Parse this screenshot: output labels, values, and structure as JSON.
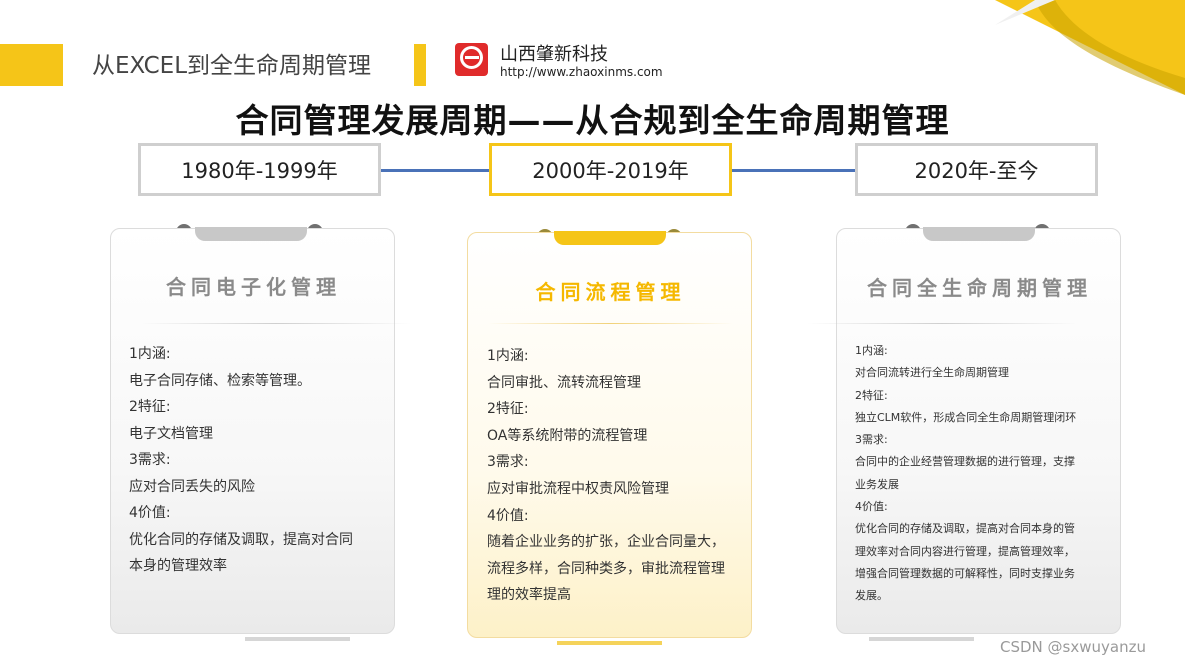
{
  "header": {
    "title": "从EXCEL到全生命周期管理",
    "company_name": "山西肇新科技",
    "company_url": "http://www.zhaoxinms.com"
  },
  "main_title": "合同管理发展周期——从合规到全生命周期管理",
  "periods": [
    {
      "label": "1980年-1999年"
    },
    {
      "label": "2000年-2019年"
    },
    {
      "label": "2020年-至今"
    }
  ],
  "cards": [
    {
      "title": "合同电子化管理",
      "lines": [
        "1内涵:",
        "电子合同存储、检索等管理。",
        "2特征:",
        "电子文档管理",
        "3需求:",
        "应对合同丢失的风险",
        "4价值:",
        "优化合同的存储及调取，提高对合同",
        "本身的管理效率"
      ]
    },
    {
      "title": "合同流程管理",
      "lines": [
        "1内涵:",
        "合同审批、流转流程管理",
        "2特征:",
        "OA等系统附带的流程管理",
        "3需求:",
        "应对审批流程中权责风险管理",
        "4价值:",
        "随着企业业务的扩张，企业合同量大，",
        "流程多样，合同种类多，审批流程管理",
        "理的效率提高"
      ]
    },
    {
      "title": "合同全生命周期管理",
      "lines": [
        "1内涵:",
        "对合同流转进行全生命周期管理",
        "2特征:",
        "独立CLM软件，形成合同全生命周期管理闭环",
        "3需求:",
        "合同中的企业经营管理数据的进行管理，支撑",
        "业务发展",
        "4价值:",
        "优化合同的存储及调取，提高对合同本身的管",
        "理效率对合同内容进行管理，提高管理效率，",
        "增强合同管理数据的可解释性，同时支撑业务",
        "发展。"
      ]
    }
  ],
  "watermark": "CSDN @sxwuyanzu",
  "colors": {
    "accent": "#f5c518",
    "timeline": "#4a72b8",
    "logo": "#e02b2b"
  }
}
